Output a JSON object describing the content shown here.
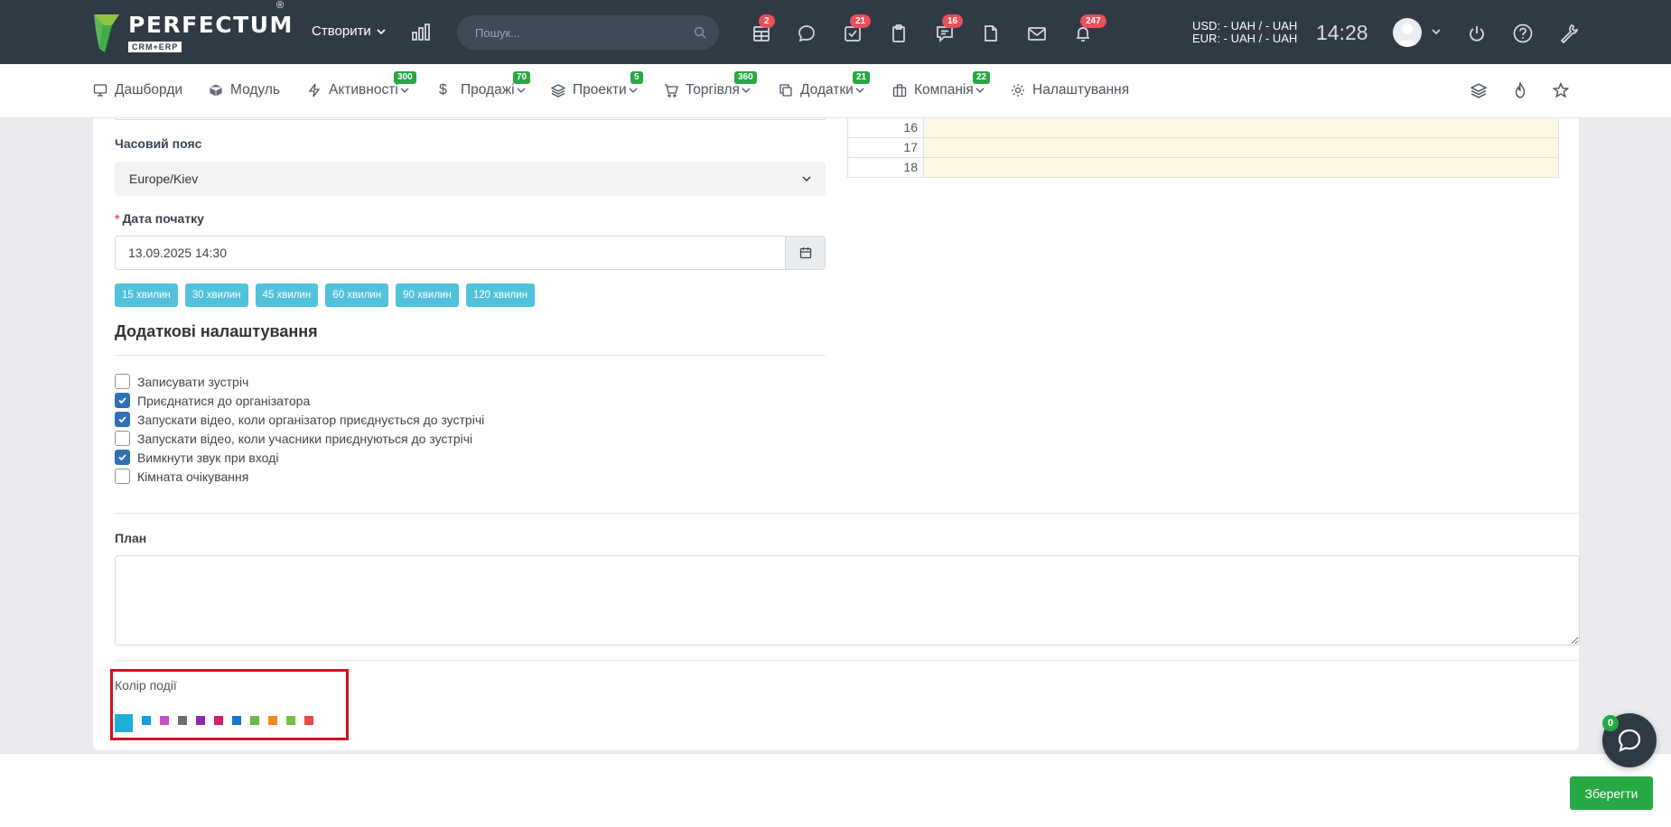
{
  "brand": {
    "name": "PERFECTUM",
    "reg": "®",
    "sub": "CRM+ERP"
  },
  "topbar": {
    "create_label": "Створити",
    "search_placeholder": "Пошук...",
    "badges": {
      "table": "2",
      "chat": "21",
      "tasks": "16",
      "notes": "247"
    },
    "currency_usd": "USD: - UAH / - UAH",
    "currency_eur": "EUR: - UAH / - UAH",
    "clock": "14:28"
  },
  "nav": {
    "items": [
      {
        "label": "Дашборди",
        "badge": ""
      },
      {
        "label": "Модуль",
        "badge": ""
      },
      {
        "label": "Активності",
        "badge": "300"
      },
      {
        "label": "Продажі",
        "badge": "70"
      },
      {
        "label": "Проекти",
        "badge": "5"
      },
      {
        "label": "Торгівля",
        "badge": "360"
      },
      {
        "label": "Додатки",
        "badge": "21"
      },
      {
        "label": "Компанія",
        "badge": "22"
      },
      {
        "label": "Налаштування",
        "badge": ""
      }
    ]
  },
  "form": {
    "timezone_label": "Часовий пояс",
    "timezone_value": "Europe/Kiev",
    "start_label": "Дата початку",
    "start_value": "13.09.2025 14:30",
    "durations": [
      "15 хвилин",
      "30 хвилин",
      "45 хвилин",
      "60 хвилин",
      "90 хвилин",
      "120 хвилин"
    ],
    "extra_title": "Додаткові налаштування",
    "options": [
      {
        "label": "Записувати зустріч",
        "checked": false
      },
      {
        "label": "Приєднатися до організатора",
        "checked": true
      },
      {
        "label": "Запускати відео, коли організатор приєднується до зустрічі",
        "checked": true
      },
      {
        "label": "Запускати відео, коли учасники приєднуються до зустрічі",
        "checked": false
      },
      {
        "label": "Вимкнути звук при вході",
        "checked": true
      },
      {
        "label": "Кімната очікування",
        "checked": false
      }
    ],
    "plan_label": "План",
    "color_label": "Колір події",
    "colors": [
      "#1fb0d6",
      "#1a9be0",
      "#c94fc5",
      "#6b6f72",
      "#8e2aa7",
      "#d11f6a",
      "#1577d1",
      "#6cb84a",
      "#f08a1d",
      "#7ac142",
      "#e84848"
    ]
  },
  "schedule": {
    "rows": [
      "16",
      "17",
      "18"
    ]
  },
  "footer": {
    "save_label": "Зберегти",
    "chat_badge": "0"
  }
}
